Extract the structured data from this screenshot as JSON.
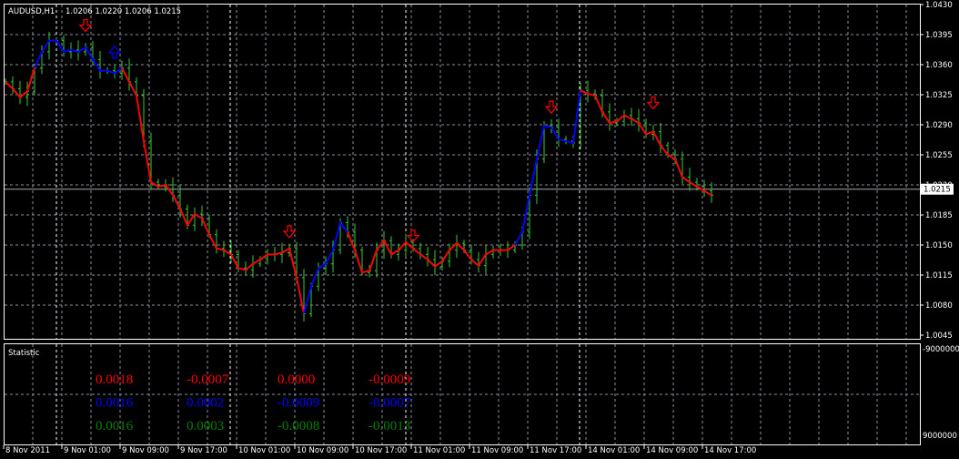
{
  "header": {
    "symbol": "AUDUSD,H1",
    "ohlc": "1.0206 1.0220 1.0206 1.0215"
  },
  "price_axis": {
    "ticks": [
      "1.0430",
      "1.0395",
      "1.0360",
      "1.0325",
      "1.0290",
      "1.0255",
      "1.0220",
      "1.0185",
      "1.0150",
      "1.0115",
      "1.0080",
      "1.0045"
    ],
    "max": 1.043,
    "min": 1.0045,
    "current": "1.0215",
    "current_value": 1.0215
  },
  "sub_axis": {
    "top": "-9000000",
    "bottom": "9000000"
  },
  "subwindow": {
    "title": "Statistic",
    "rows": [
      {
        "color": "#ff0000",
        "values": [
          "0.0018",
          "-0.0007",
          "0.0000",
          "-0.0009"
        ]
      },
      {
        "color": "#0000ff",
        "values": [
          "0.0016",
          "0.0002",
          "-0.0009",
          "-0.0007"
        ]
      },
      {
        "color": "#008000",
        "values": [
          "0.0016",
          "0.0003",
          "-0.0008",
          "-0.0013"
        ]
      }
    ]
  },
  "time_axis": {
    "labels": [
      "8 Nov 2011",
      "9 Nov 01:00",
      "9 Nov 09:00",
      "9 Nov 17:00",
      "10 Nov 01:00",
      "10 Nov 09:00",
      "10 Nov 17:00",
      "11 Nov 01:00",
      "11 Nov 09:00",
      "11 Nov 17:00",
      "14 Nov 01:00",
      "14 Nov 09:00",
      "14 Nov 17:00"
    ],
    "bars_per_label": 8
  },
  "colors": {
    "down": "#ff0000",
    "up": "#0000ff",
    "bars": "#32cd32",
    "grid": "#8a8f9a"
  },
  "series": {
    "closes": [
      1.034,
      1.0332,
      1.0322,
      1.0329,
      1.0356,
      1.0375,
      1.0388,
      1.0388,
      1.0375,
      1.0377,
      1.0375,
      1.038,
      1.0366,
      1.0353,
      1.0353,
      1.035,
      1.0356,
      1.034,
      1.0324,
      1.0271,
      1.0223,
      1.0218,
      1.022,
      1.0208,
      1.0192,
      1.0173,
      1.0186,
      1.0181,
      1.0162,
      1.0146,
      1.0144,
      1.0139,
      1.0123,
      1.0121,
      1.0128,
      1.0133,
      1.0139,
      1.0139,
      1.0141,
      1.0146,
      1.0112,
      1.007,
      1.0102,
      1.0123,
      1.0128,
      1.0144,
      1.0176,
      1.0165,
      1.0144,
      1.0118,
      1.012,
      1.0144,
      1.0155,
      1.0139,
      1.0144,
      1.0153,
      1.0146,
      1.0139,
      1.0133,
      1.0125,
      1.0131,
      1.0144,
      1.0152,
      1.0144,
      1.0133,
      1.0126,
      1.0139,
      1.0144,
      1.0144,
      1.0144,
      1.015,
      1.0165,
      1.0208,
      1.025,
      1.0289,
      1.0287,
      1.0273,
      1.0271,
      1.0269,
      1.033,
      1.0326,
      1.0324,
      1.0305,
      1.0292,
      1.0294,
      1.0301,
      1.0297,
      1.0292,
      1.0279,
      1.0282,
      1.0266,
      1.0255,
      1.025,
      1.0229,
      1.0223,
      1.0218,
      1.0213,
      1.0208
    ],
    "segments": [
      {
        "from": 0,
        "to": 4,
        "trend": "down"
      },
      {
        "from": 4,
        "to": 16,
        "trend": "up"
      },
      {
        "from": 16,
        "to": 41,
        "trend": "down"
      },
      {
        "from": 41,
        "to": 47,
        "trend": "up"
      },
      {
        "from": 47,
        "to": 70,
        "trend": "down"
      },
      {
        "from": 70,
        "to": 79,
        "trend": "up"
      },
      {
        "from": 79,
        "to": 97,
        "trend": "down"
      }
    ],
    "arrows": [
      {
        "bar": 11,
        "price": 1.0405,
        "type": "down"
      },
      {
        "bar": 15,
        "price": 1.0375,
        "type": "up"
      },
      {
        "bar": 39,
        "price": 1.0165,
        "type": "down"
      },
      {
        "bar": 56,
        "price": 1.016,
        "type": "down"
      },
      {
        "bar": 75,
        "price": 1.031,
        "type": "down"
      },
      {
        "bar": 89,
        "price": 1.0315,
        "type": "down"
      }
    ]
  }
}
